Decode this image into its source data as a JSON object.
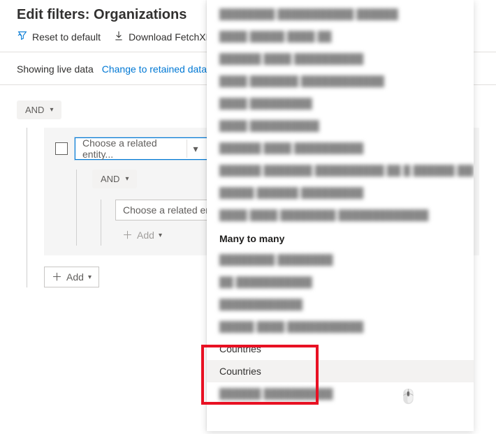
{
  "header": {
    "title": "Edit filters: Organizations"
  },
  "toolbar": {
    "reset_label": "Reset to default",
    "download_label": "Download FetchXM"
  },
  "status": {
    "text": "Showing live data",
    "link": "Change to retained data"
  },
  "filters": {
    "root_operator": "AND",
    "entity_placeholder": "Choose a related entity...",
    "nested_operator": "AND",
    "nested_entity_placeholder": "Choose a related entity...",
    "add_label": "Add"
  },
  "dropdown": {
    "section_header": "Many to many",
    "blurred_items_top": [
      "blurred-item-1",
      "blurred-item-2",
      "blurred-item-3",
      "blurred-item-4",
      "blurred-item-5",
      "blurred-item-6",
      "blurred-item-7",
      "blurred-item-8",
      "blurred-item-9",
      "blurred-item-10"
    ],
    "blurred_items_mid": [
      "blurred-m-1",
      "blurred-m-2",
      "blurred-m-3",
      "blurred-m-4"
    ],
    "items": [
      {
        "label": "Countries"
      },
      {
        "label": "Countries"
      }
    ],
    "blurred_items_bottom": [
      "blurred-b-1"
    ]
  }
}
